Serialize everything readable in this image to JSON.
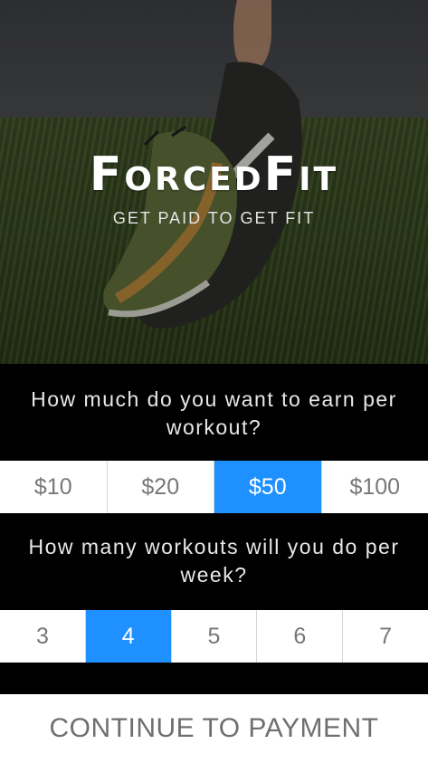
{
  "hero": {
    "logo": "ForcedFit",
    "tagline": "GET PAID TO GET FIT"
  },
  "earn": {
    "question": "How much do you want to earn per workout?",
    "options": [
      "$10",
      "$20",
      "$50",
      "$100"
    ],
    "selected": "$50"
  },
  "workouts": {
    "question": "How many workouts will you do per week?",
    "options": [
      "3",
      "4",
      "5",
      "6",
      "7"
    ],
    "selected": "4"
  },
  "cta": {
    "label": "CONTINUE TO PAYMENT"
  },
  "colors": {
    "accent": "#1e90ff",
    "background": "#000000"
  }
}
